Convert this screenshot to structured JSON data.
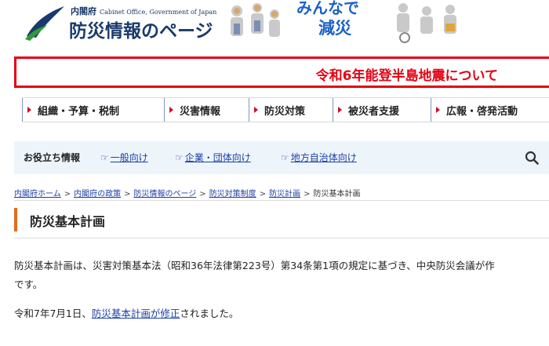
{
  "header": {
    "org_ja": "内閣府",
    "org_en": "Cabinet Office, Government of Japan",
    "site_title": "防災情報のページ",
    "banner_line1": "みんなで",
    "banner_line2": "減災"
  },
  "alert": {
    "text": "令和6年能登半島地震について"
  },
  "nav": {
    "items": [
      "組織・予算・税制",
      "災害情報",
      "防災対策",
      "被災者支援",
      "広報・啓発活動"
    ]
  },
  "useful": {
    "label": "お役立ち情報",
    "links": [
      "一般向け",
      "企業・団体向け",
      "地方自治体向け"
    ]
  },
  "breadcrumb": {
    "items": [
      "内閣府ホーム",
      "内閣府の政策",
      "防災情報のページ",
      "防災対策制度",
      "防災計画"
    ],
    "current": "防災基本計画"
  },
  "page": {
    "title": "防災基本計画",
    "para1_line1": "防災基本計画は、災害対策基本法（昭和36年法律第223号）第34条第1項の規定に基づき、中央防災会議が作",
    "para1_line2": "です。",
    "para2_prefix": "令和7年7月1日、",
    "para2_link": "防災基本計画が修正",
    "para2_suffix": "されました。"
  },
  "colors": {
    "alert_red": "#e60012",
    "nav_arrow": "#c8102e",
    "link_blue": "#1c3ea6",
    "title_accent": "#e06c1f",
    "header_navy": "#1a3a6b"
  }
}
